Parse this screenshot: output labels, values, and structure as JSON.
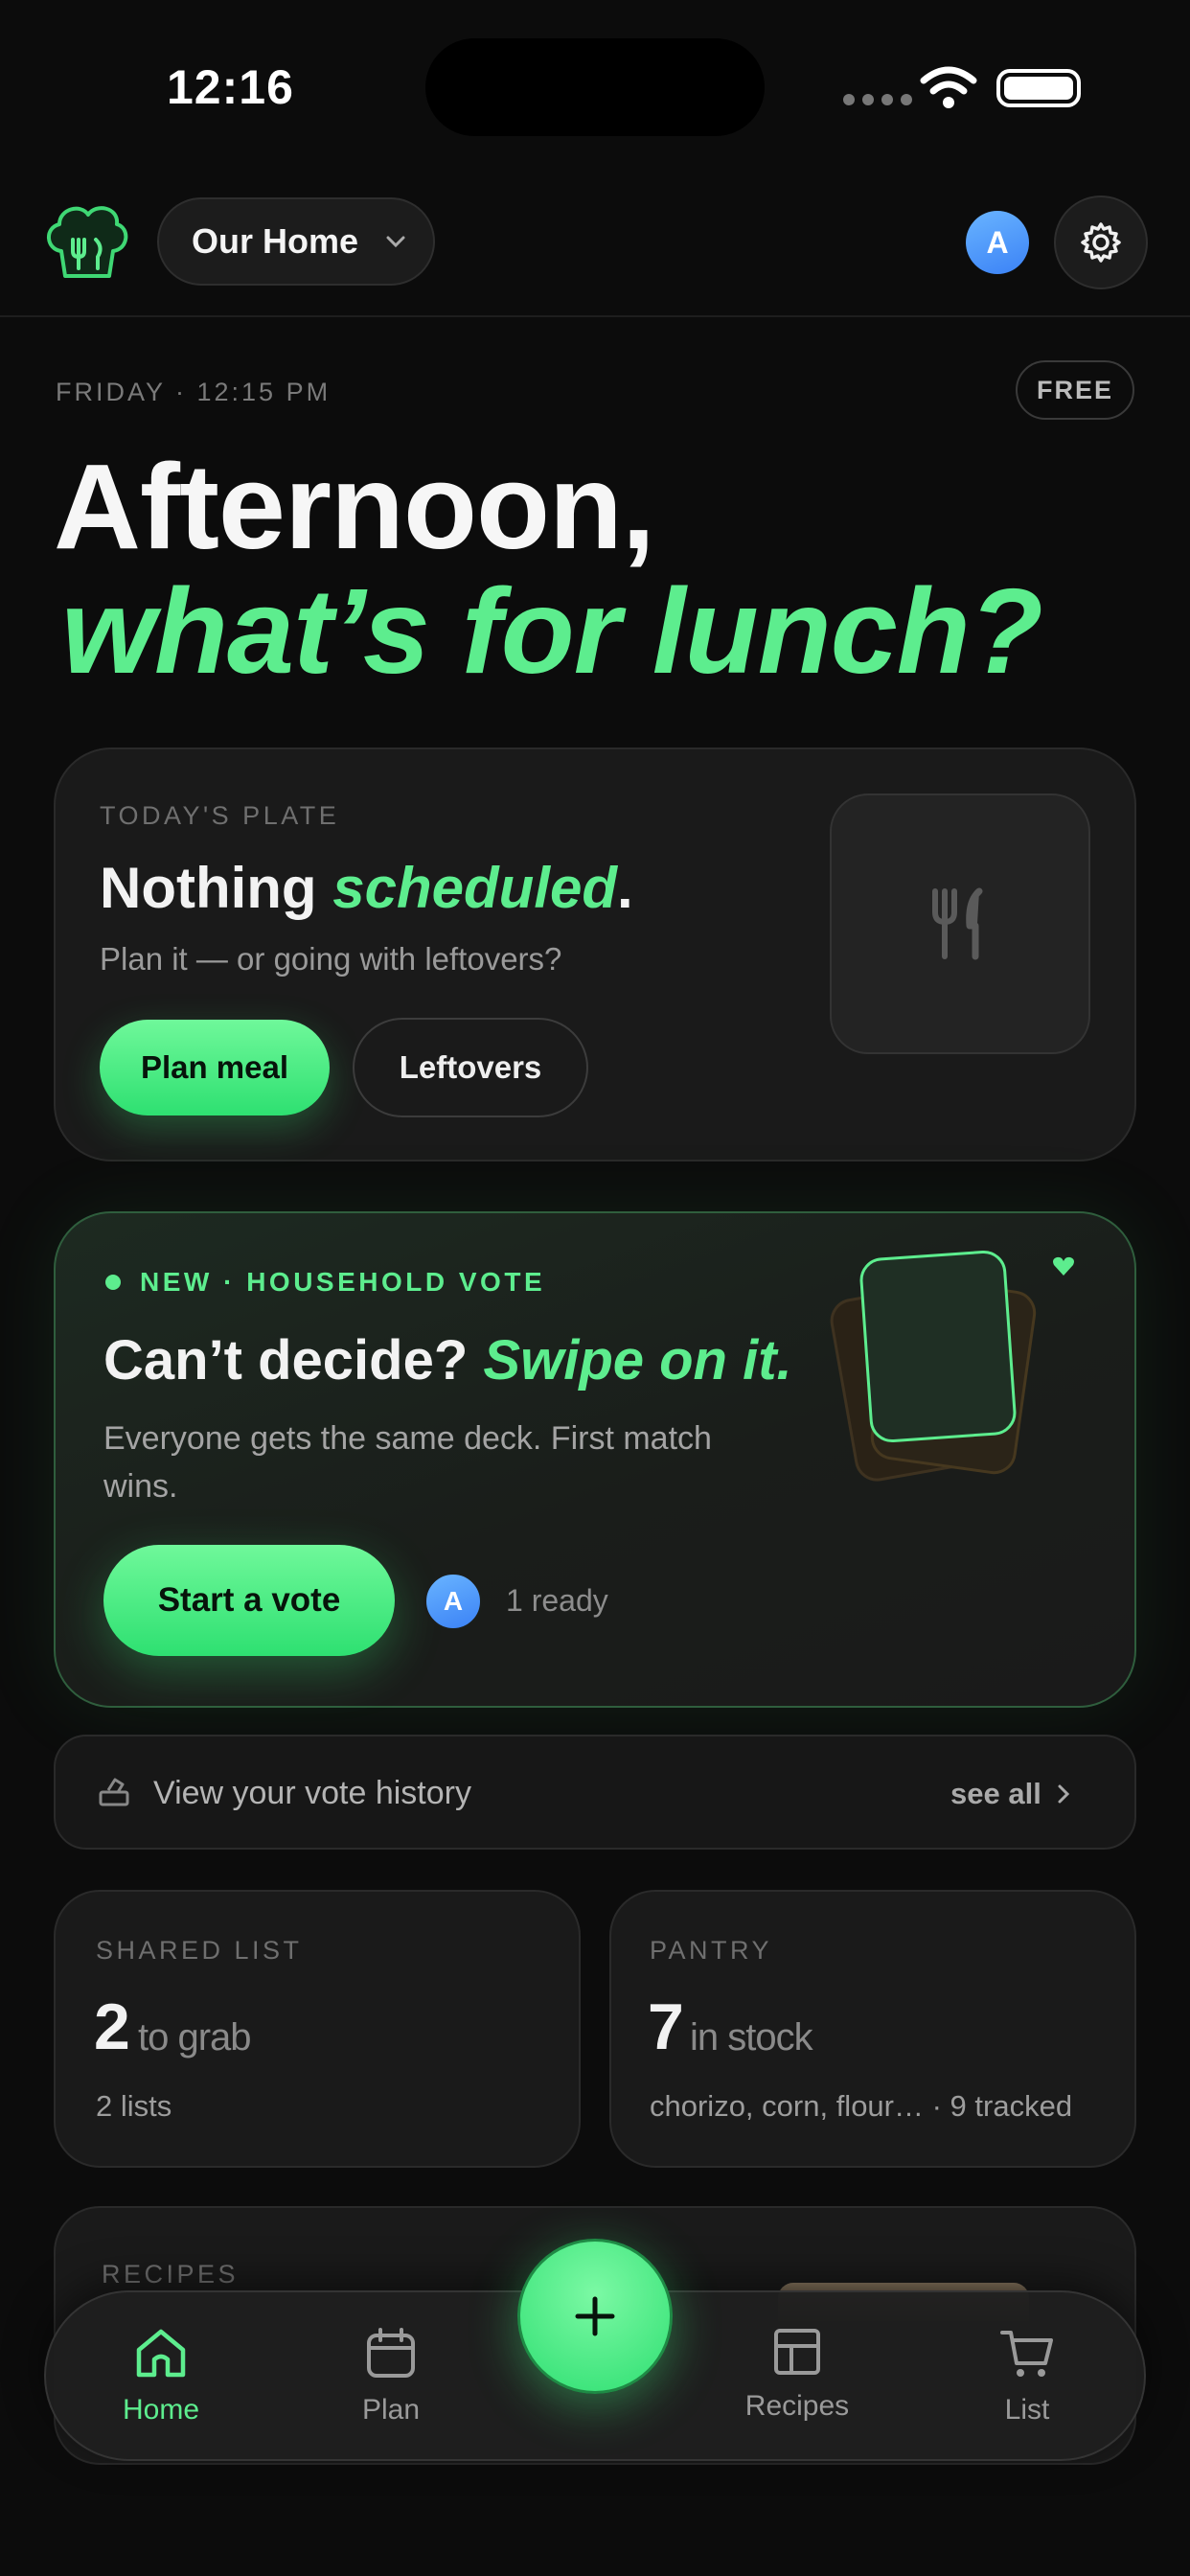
{
  "status_bar": {
    "time": "12:16"
  },
  "header": {
    "household": "Our Home",
    "avatar_initial": "A",
    "accent_color": "#5ded8e"
  },
  "greeting": {
    "dateline": "FRIDAY · 12:15 PM",
    "plan_badge": "FREE",
    "line1": "Afternoon,",
    "line2": "what’s for lunch?"
  },
  "today_card": {
    "eyebrow": "TODAY'S PLATE",
    "title_plain": "Nothing ",
    "title_accent": "scheduled",
    "title_end": ".",
    "subtitle": "Plan it — or going with leftovers?",
    "primary_button": "Plan meal",
    "secondary_button": "Leftovers",
    "icon": "fork-knife-icon"
  },
  "vote_card": {
    "eyebrow": "NEW · HOUSEHOLD VOTE",
    "title_plain": "Can’t decide? ",
    "title_accent": "Swipe on it.",
    "description": "Everyone gets the same deck. First match wins.",
    "button": "Start a vote",
    "avatar_initial": "A",
    "ready_text": "1 ready"
  },
  "history": {
    "label": "View your vote history",
    "link": "see all"
  },
  "shared_list": {
    "eyebrow": "SHARED LIST",
    "count": "2",
    "unit": "to grab",
    "sub": "2 lists"
  },
  "pantry": {
    "eyebrow": "PANTRY",
    "count": "7",
    "unit": "in stock",
    "sub": "chorizo, corn, flour… · 9 tracked"
  },
  "recipes": {
    "eyebrow": "RECIPES"
  },
  "tabbar": {
    "tabs": [
      {
        "label": "Home",
        "icon": "home-icon",
        "active": true
      },
      {
        "label": "Plan",
        "icon": "calendar-icon",
        "active": false
      },
      {
        "label": "Recipes",
        "icon": "grid-icon",
        "active": false
      },
      {
        "label": "List",
        "icon": "cart-icon",
        "active": false
      }
    ],
    "fab_icon": "plus-icon"
  }
}
